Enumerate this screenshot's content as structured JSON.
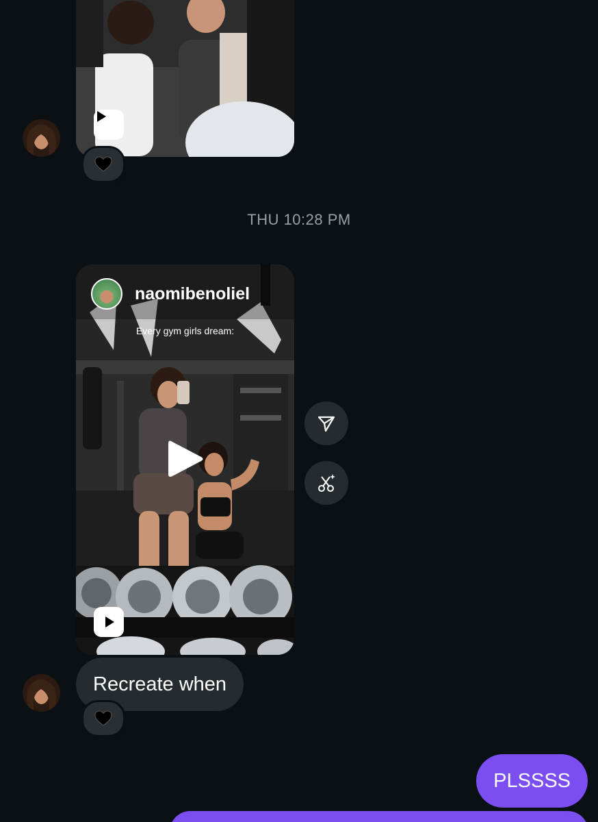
{
  "conversation": {
    "timestamp": "THU 10:28 PM",
    "messages": [
      {
        "type": "video",
        "sender": "them",
        "reaction": "black-heart"
      },
      {
        "type": "reel",
        "sender": "them",
        "username": "naomibenoliel",
        "caption": "Every gym girls dream:",
        "side_actions": [
          "share-icon",
          "remix-icon"
        ]
      },
      {
        "type": "text",
        "sender": "them",
        "text": "Recreate when",
        "reaction": "black-heart"
      },
      {
        "type": "text",
        "sender": "me",
        "text": "PLSSSS"
      }
    ]
  },
  "colors": {
    "background": "#0b1014",
    "incoming_bubble": "#262b2f",
    "outgoing_bubble": "#7b4ef2",
    "timestamp_text": "#98a1aa"
  },
  "icons": {
    "play": "play-icon",
    "reaction": "black-heart-icon",
    "share": "send-icon",
    "remix": "remix-icon"
  }
}
